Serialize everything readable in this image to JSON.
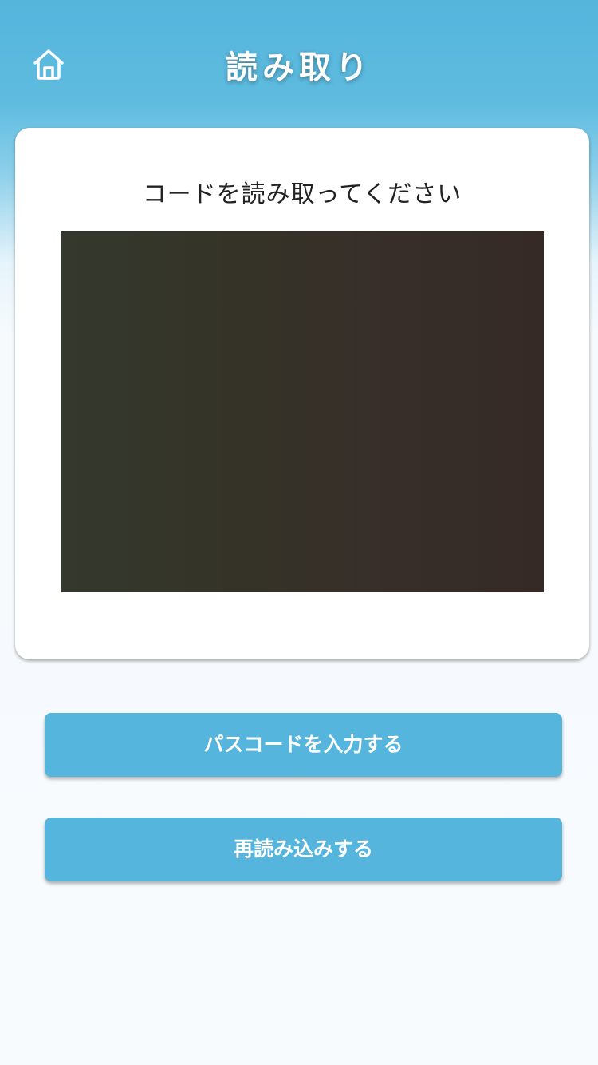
{
  "header": {
    "title": "読み取り",
    "home_icon": "home-icon"
  },
  "scanner": {
    "instruction": "コードを読み取ってください"
  },
  "actions": {
    "passcode_label": "パスコードを入力する",
    "reload_label": "再読み込みする"
  },
  "colors": {
    "accent": "#55b5dc",
    "background": "#f7fbfe",
    "card": "#ffffff",
    "camera": "#35302a"
  }
}
